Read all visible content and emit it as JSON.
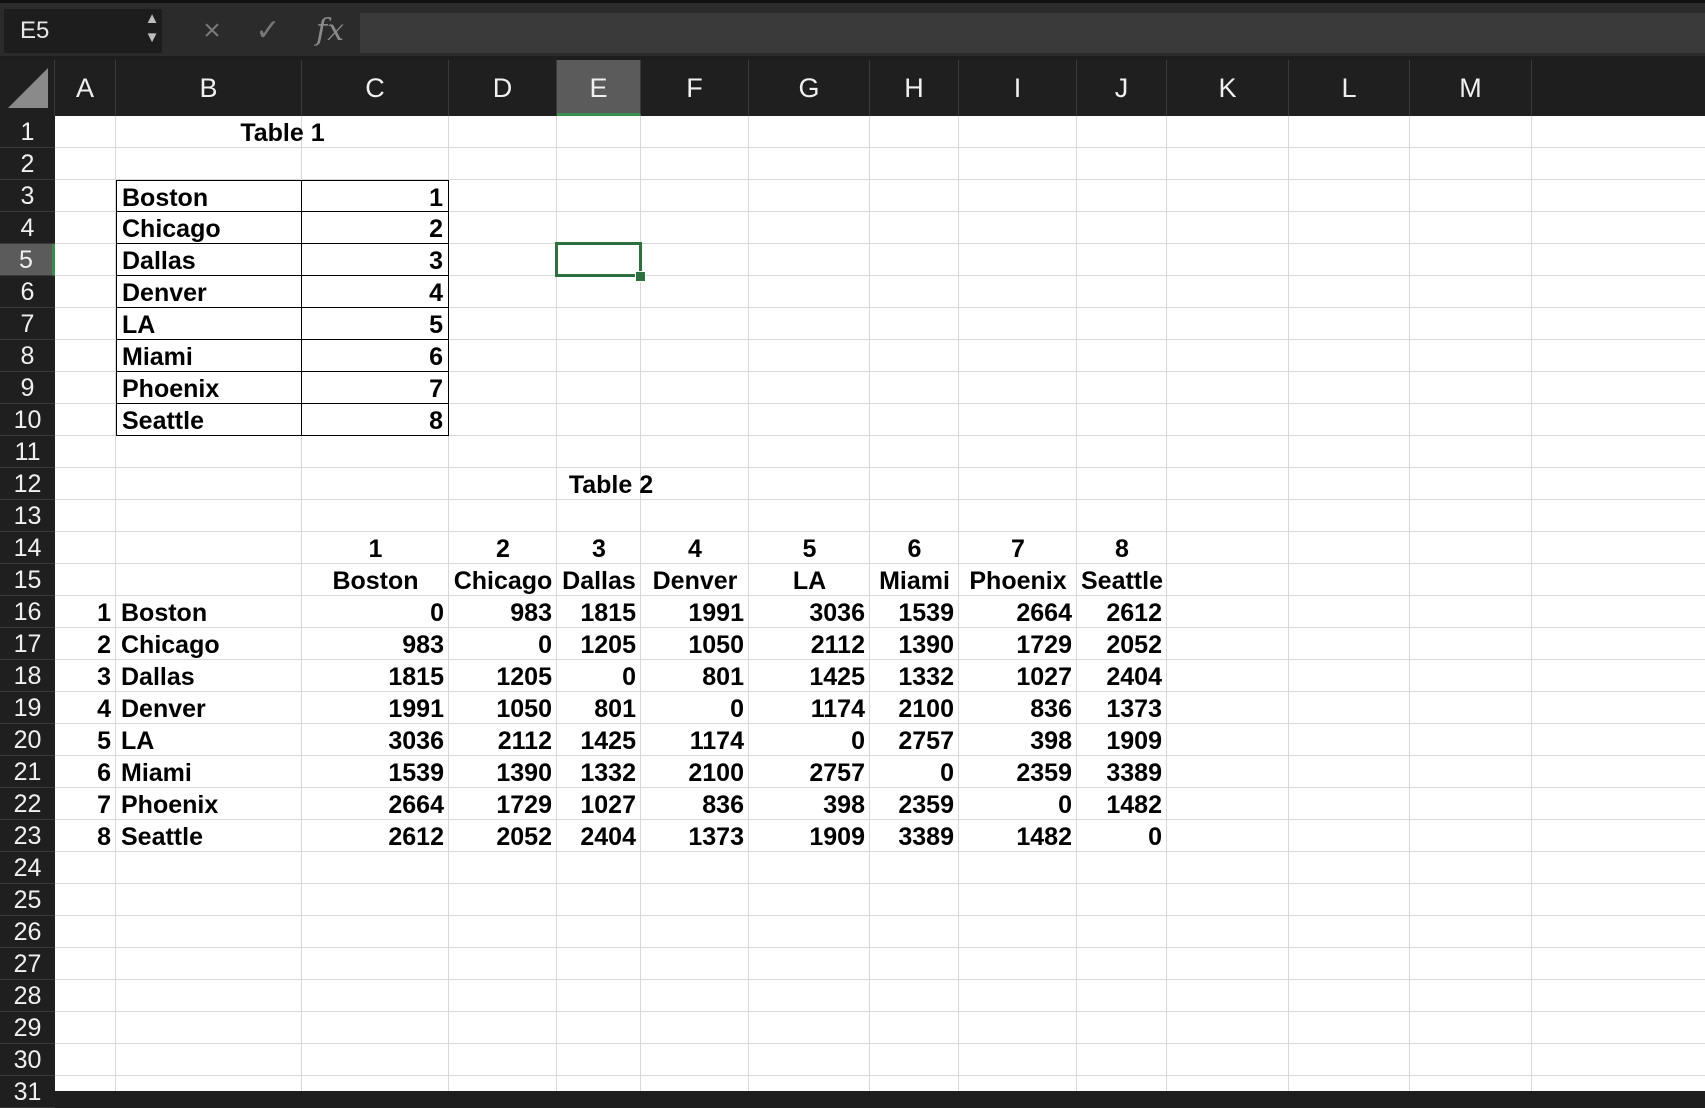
{
  "formula_bar": {
    "name_box": "E5",
    "cancel_icon": "×",
    "enter_icon": "✓",
    "fx_label": "fx",
    "formula_value": ""
  },
  "columns": [
    "A",
    "B",
    "C",
    "D",
    "E",
    "F",
    "G",
    "H",
    "I",
    "J",
    "K",
    "L",
    "M"
  ],
  "selected_column": "E",
  "rows": [
    "1",
    "2",
    "3",
    "4",
    "5",
    "6",
    "7",
    "8",
    "9",
    "10",
    "11",
    "12",
    "13",
    "14",
    "15",
    "16",
    "17",
    "18",
    "19",
    "20",
    "21",
    "22",
    "23",
    "24",
    "25",
    "26",
    "27",
    "28",
    "29",
    "30",
    "31"
  ],
  "selected_row": "5",
  "table1": {
    "title": "Table 1",
    "rows": [
      {
        "city": "Boston",
        "id": "1"
      },
      {
        "city": "Chicago",
        "id": "2"
      },
      {
        "city": "Dallas",
        "id": "3"
      },
      {
        "city": "Denver",
        "id": "4"
      },
      {
        "city": "LA",
        "id": "5"
      },
      {
        "city": "Miami",
        "id": "6"
      },
      {
        "city": "Phoenix",
        "id": "7"
      },
      {
        "city": "Seattle",
        "id": "8"
      }
    ]
  },
  "table2": {
    "title": "Table 2",
    "col_ids": [
      "1",
      "2",
      "3",
      "4",
      "5",
      "6",
      "7",
      "8"
    ],
    "col_names": [
      "Boston",
      "Chicago",
      "Dallas",
      "Denver",
      "LA",
      "Miami",
      "Phoenix",
      "Seattle"
    ],
    "rows": [
      {
        "id": "1",
        "city": "Boston",
        "values": [
          "0",
          "983",
          "1815",
          "1991",
          "3036",
          "1539",
          "2664",
          "2612"
        ]
      },
      {
        "id": "2",
        "city": "Chicago",
        "values": [
          "983",
          "0",
          "1205",
          "1050",
          "2112",
          "1390",
          "1729",
          "2052"
        ]
      },
      {
        "id": "3",
        "city": "Dallas",
        "values": [
          "1815",
          "1205",
          "0",
          "801",
          "1425",
          "1332",
          "1027",
          "2404"
        ]
      },
      {
        "id": "4",
        "city": "Denver",
        "values": [
          "1991",
          "1050",
          "801",
          "0",
          "1174",
          "2100",
          "836",
          "1373"
        ]
      },
      {
        "id": "5",
        "city": "LA",
        "values": [
          "3036",
          "2112",
          "1425",
          "1174",
          "0",
          "2757",
          "398",
          "1909"
        ]
      },
      {
        "id": "6",
        "city": "Miami",
        "values": [
          "1539",
          "1390",
          "1332",
          "2100",
          "2757",
          "0",
          "2359",
          "3389"
        ]
      },
      {
        "id": "7",
        "city": "Phoenix",
        "values": [
          "2664",
          "1729",
          "1027",
          "836",
          "398",
          "2359",
          "0",
          "1482"
        ]
      },
      {
        "id": "8",
        "city": "Seattle",
        "values": [
          "2612",
          "2052",
          "2404",
          "1373",
          "1909",
          "3389",
          "1482",
          "0"
        ]
      }
    ]
  },
  "colors": {
    "selection": "#2f6f3f",
    "header_bg": "#1f1f1f",
    "selected_header_bg": "#5b5b5b"
  }
}
